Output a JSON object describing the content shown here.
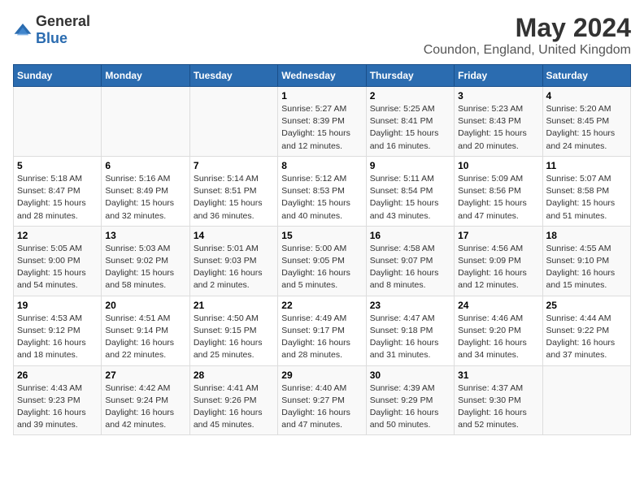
{
  "logo": {
    "text_general": "General",
    "text_blue": "Blue"
  },
  "title": "May 2024",
  "subtitle": "Coundon, England, United Kingdom",
  "days_of_week": [
    "Sunday",
    "Monday",
    "Tuesday",
    "Wednesday",
    "Thursday",
    "Friday",
    "Saturday"
  ],
  "weeks": [
    [
      {
        "day": "",
        "info": ""
      },
      {
        "day": "",
        "info": ""
      },
      {
        "day": "",
        "info": ""
      },
      {
        "day": "1",
        "info": "Sunrise: 5:27 AM\nSunset: 8:39 PM\nDaylight: 15 hours\nand 12 minutes."
      },
      {
        "day": "2",
        "info": "Sunrise: 5:25 AM\nSunset: 8:41 PM\nDaylight: 15 hours\nand 16 minutes."
      },
      {
        "day": "3",
        "info": "Sunrise: 5:23 AM\nSunset: 8:43 PM\nDaylight: 15 hours\nand 20 minutes."
      },
      {
        "day": "4",
        "info": "Sunrise: 5:20 AM\nSunset: 8:45 PM\nDaylight: 15 hours\nand 24 minutes."
      }
    ],
    [
      {
        "day": "5",
        "info": "Sunrise: 5:18 AM\nSunset: 8:47 PM\nDaylight: 15 hours\nand 28 minutes."
      },
      {
        "day": "6",
        "info": "Sunrise: 5:16 AM\nSunset: 8:49 PM\nDaylight: 15 hours\nand 32 minutes."
      },
      {
        "day": "7",
        "info": "Sunrise: 5:14 AM\nSunset: 8:51 PM\nDaylight: 15 hours\nand 36 minutes."
      },
      {
        "day": "8",
        "info": "Sunrise: 5:12 AM\nSunset: 8:53 PM\nDaylight: 15 hours\nand 40 minutes."
      },
      {
        "day": "9",
        "info": "Sunrise: 5:11 AM\nSunset: 8:54 PM\nDaylight: 15 hours\nand 43 minutes."
      },
      {
        "day": "10",
        "info": "Sunrise: 5:09 AM\nSunset: 8:56 PM\nDaylight: 15 hours\nand 47 minutes."
      },
      {
        "day": "11",
        "info": "Sunrise: 5:07 AM\nSunset: 8:58 PM\nDaylight: 15 hours\nand 51 minutes."
      }
    ],
    [
      {
        "day": "12",
        "info": "Sunrise: 5:05 AM\nSunset: 9:00 PM\nDaylight: 15 hours\nand 54 minutes."
      },
      {
        "day": "13",
        "info": "Sunrise: 5:03 AM\nSunset: 9:02 PM\nDaylight: 15 hours\nand 58 minutes."
      },
      {
        "day": "14",
        "info": "Sunrise: 5:01 AM\nSunset: 9:03 PM\nDaylight: 16 hours\nand 2 minutes."
      },
      {
        "day": "15",
        "info": "Sunrise: 5:00 AM\nSunset: 9:05 PM\nDaylight: 16 hours\nand 5 minutes."
      },
      {
        "day": "16",
        "info": "Sunrise: 4:58 AM\nSunset: 9:07 PM\nDaylight: 16 hours\nand 8 minutes."
      },
      {
        "day": "17",
        "info": "Sunrise: 4:56 AM\nSunset: 9:09 PM\nDaylight: 16 hours\nand 12 minutes."
      },
      {
        "day": "18",
        "info": "Sunrise: 4:55 AM\nSunset: 9:10 PM\nDaylight: 16 hours\nand 15 minutes."
      }
    ],
    [
      {
        "day": "19",
        "info": "Sunrise: 4:53 AM\nSunset: 9:12 PM\nDaylight: 16 hours\nand 18 minutes."
      },
      {
        "day": "20",
        "info": "Sunrise: 4:51 AM\nSunset: 9:14 PM\nDaylight: 16 hours\nand 22 minutes."
      },
      {
        "day": "21",
        "info": "Sunrise: 4:50 AM\nSunset: 9:15 PM\nDaylight: 16 hours\nand 25 minutes."
      },
      {
        "day": "22",
        "info": "Sunrise: 4:49 AM\nSunset: 9:17 PM\nDaylight: 16 hours\nand 28 minutes."
      },
      {
        "day": "23",
        "info": "Sunrise: 4:47 AM\nSunset: 9:18 PM\nDaylight: 16 hours\nand 31 minutes."
      },
      {
        "day": "24",
        "info": "Sunrise: 4:46 AM\nSunset: 9:20 PM\nDaylight: 16 hours\nand 34 minutes."
      },
      {
        "day": "25",
        "info": "Sunrise: 4:44 AM\nSunset: 9:22 PM\nDaylight: 16 hours\nand 37 minutes."
      }
    ],
    [
      {
        "day": "26",
        "info": "Sunrise: 4:43 AM\nSunset: 9:23 PM\nDaylight: 16 hours\nand 39 minutes."
      },
      {
        "day": "27",
        "info": "Sunrise: 4:42 AM\nSunset: 9:24 PM\nDaylight: 16 hours\nand 42 minutes."
      },
      {
        "day": "28",
        "info": "Sunrise: 4:41 AM\nSunset: 9:26 PM\nDaylight: 16 hours\nand 45 minutes."
      },
      {
        "day": "29",
        "info": "Sunrise: 4:40 AM\nSunset: 9:27 PM\nDaylight: 16 hours\nand 47 minutes."
      },
      {
        "day": "30",
        "info": "Sunrise: 4:39 AM\nSunset: 9:29 PM\nDaylight: 16 hours\nand 50 minutes."
      },
      {
        "day": "31",
        "info": "Sunrise: 4:37 AM\nSunset: 9:30 PM\nDaylight: 16 hours\nand 52 minutes."
      },
      {
        "day": "",
        "info": ""
      }
    ]
  ]
}
